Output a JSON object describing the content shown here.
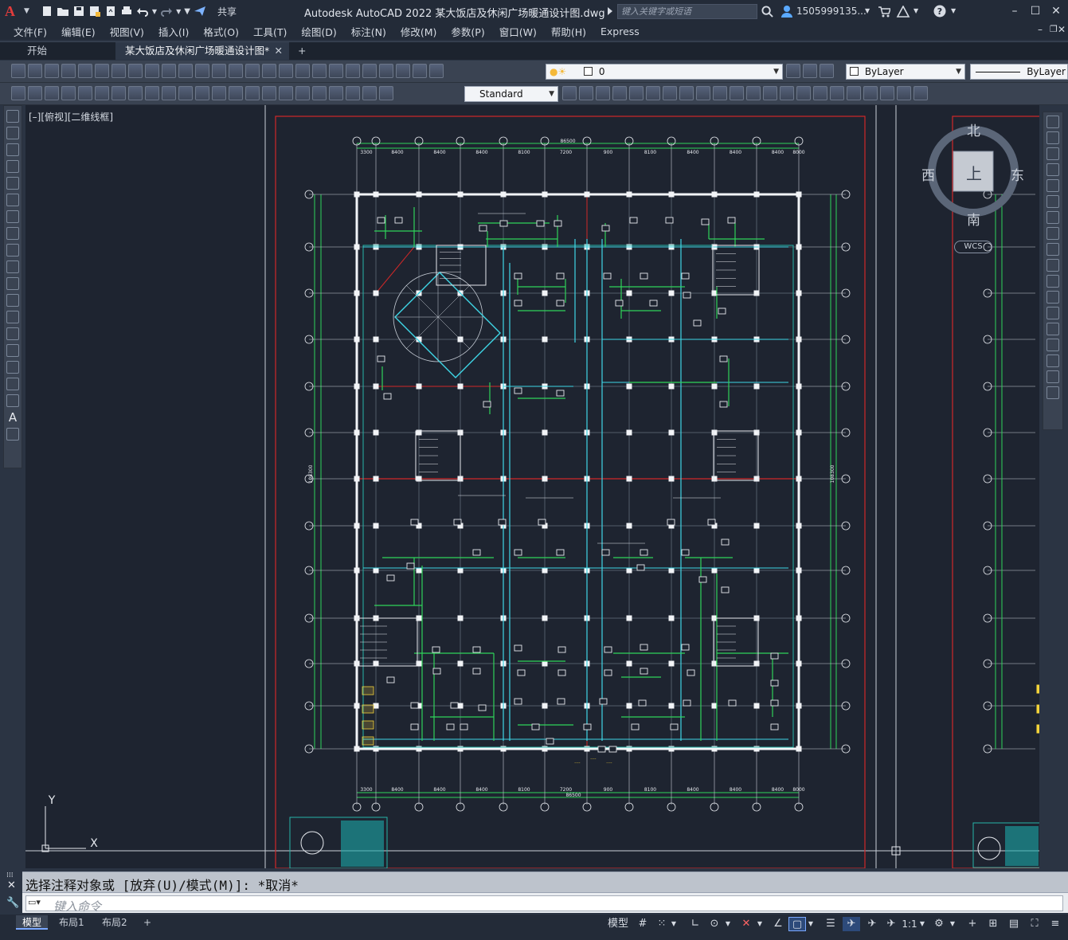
{
  "title_bar": {
    "logo": "A",
    "share_label": "共享",
    "app_title": "Autodesk AutoCAD 2022    某大饭店及休闲广场暖通设计图.dwg",
    "search_placeholder": "键入关键字或短语",
    "user": "1505999135...",
    "icons": [
      "new-icon",
      "open-icon",
      "save-icon",
      "saveas-icon",
      "plot-icon",
      "undo-icon",
      "redo-icon",
      "share-icon",
      "search-icon",
      "user-icon",
      "cart-icon",
      "a360-icon",
      "help-icon",
      "minimize-icon",
      "maximize-icon",
      "close-icon"
    ]
  },
  "menu": [
    "文件(F)",
    "编辑(E)",
    "视图(V)",
    "插入(I)",
    "格式(O)",
    "工具(T)",
    "绘图(D)",
    "标注(N)",
    "修改(M)",
    "参数(P)",
    "窗口(W)",
    "帮助(H)",
    "Express"
  ],
  "tabs": {
    "start": "开始",
    "active": "某大饭店及休闲广场暖通设计图*",
    "close": "✕",
    "add": "+"
  },
  "toolbar1": {
    "layer_value": "0",
    "color_value": "ByLayer",
    "linetype_value": "ByLayer"
  },
  "toolbar2": {
    "text_style": "Standard"
  },
  "viewport": {
    "label": "[–][俯视][二维线框]",
    "viewcube": {
      "north": "北",
      "south": "南",
      "east": "东",
      "west": "西",
      "face": "上"
    },
    "wcs": "WCS",
    "ucs_x": "X",
    "ucs_y": "Y"
  },
  "drawing": {
    "top_total": "86500",
    "bottom_total": "86500",
    "top_dims": [
      "3300",
      "8400",
      "8400",
      "8400",
      "8100",
      "7200",
      "900",
      "8100",
      "8400",
      "8400",
      "8400",
      "8000"
    ],
    "left_total": "108300",
    "right_total": "108300"
  },
  "command": {
    "history": "选择注释对象或 [放弃(U)/模式(M)]: *取消*",
    "placeholder": "键入命令"
  },
  "status": {
    "layouts": [
      "模型",
      "布局1",
      "布局2"
    ],
    "add": "+",
    "model_label": "模型",
    "scale": "1:1"
  }
}
